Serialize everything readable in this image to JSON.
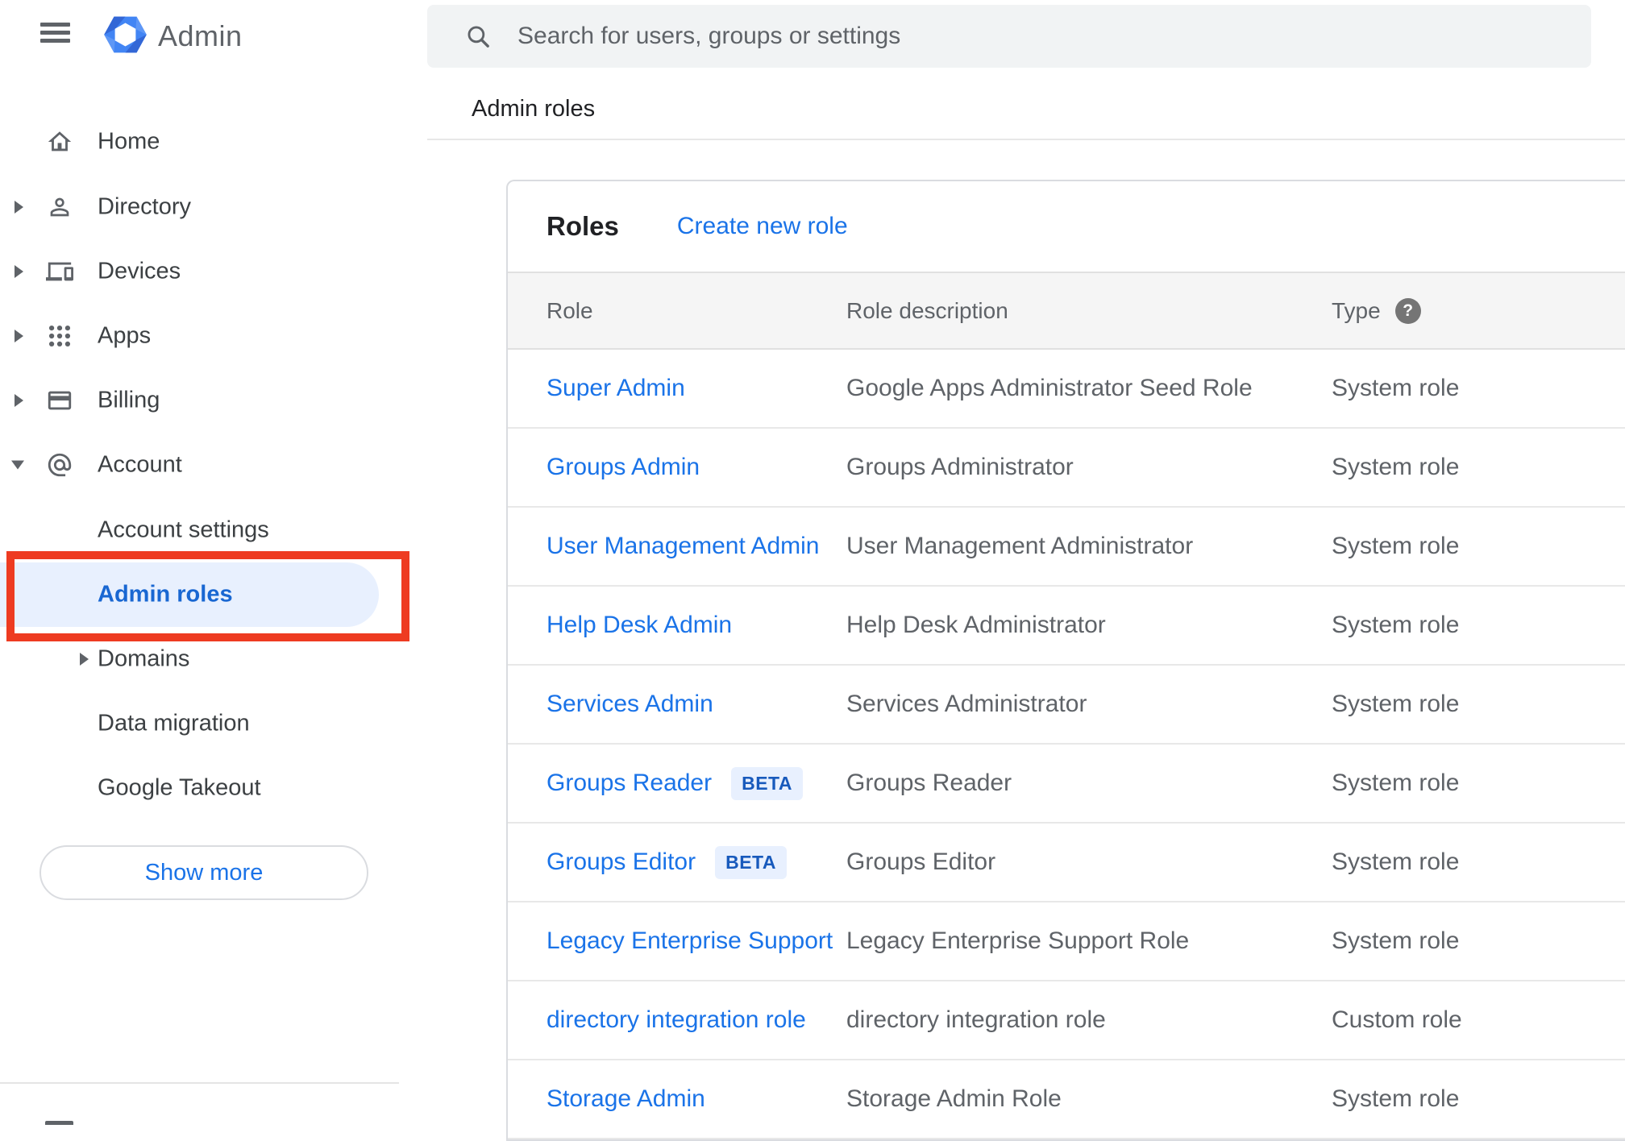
{
  "header": {
    "app_title": "Admin",
    "search_placeholder": "Search for users, groups or settings",
    "breadcrumb": "Admin roles"
  },
  "sidebar": {
    "items": [
      {
        "label": "Home",
        "icon": "home-icon"
      },
      {
        "label": "Directory",
        "icon": "person-icon"
      },
      {
        "label": "Devices",
        "icon": "devices-icon"
      },
      {
        "label": "Apps",
        "icon": "apps-grid-icon"
      },
      {
        "label": "Billing",
        "icon": "credit-card-icon"
      },
      {
        "label": "Account",
        "icon": "at-sign-icon"
      }
    ],
    "account_children": [
      {
        "label": "Account settings"
      },
      {
        "label": "Admin roles",
        "active": true
      },
      {
        "label": "Domains"
      },
      {
        "label": "Data migration"
      },
      {
        "label": "Google Takeout"
      }
    ],
    "show_more_label": "Show more"
  },
  "main": {
    "card_title": "Roles",
    "create_link_label": "Create new role",
    "table": {
      "columns": [
        "Role",
        "Role description",
        "Type"
      ],
      "type_help_glyph": "?",
      "rows": [
        {
          "role": "Super Admin",
          "description": "Google Apps Administrator Seed Role",
          "type": "System role"
        },
        {
          "role": "Groups Admin",
          "description": "Groups Administrator",
          "type": "System role"
        },
        {
          "role": "User Management Admin",
          "description": "User Management Administrator",
          "type": "System role"
        },
        {
          "role": "Help Desk Admin",
          "description": "Help Desk Administrator",
          "type": "System role"
        },
        {
          "role": "Services Admin",
          "description": "Services Administrator",
          "type": "System role"
        },
        {
          "role": "Groups Reader",
          "badge": "BETA",
          "description": "Groups Reader",
          "type": "System role"
        },
        {
          "role": "Groups Editor",
          "badge": "BETA",
          "description": "Groups Editor",
          "type": "System role"
        },
        {
          "role": "Legacy Enterprise Support",
          "description": "Legacy Enterprise Support Role",
          "type": "System role"
        },
        {
          "role": "directory integration role",
          "description": "directory integration role",
          "type": "Custom role"
        },
        {
          "role": "Storage Admin",
          "description": "Storage Admin Role",
          "type": "System role"
        }
      ]
    }
  },
  "colors": {
    "link_blue": "#1a73e8",
    "active_item_blue": "#1967d2",
    "active_item_bg": "#e8f0fe",
    "annotation_red": "#ee3b21",
    "beta_text": "#185abc",
    "beta_bg": "#e8f0fe",
    "search_bg": "#f1f3f4",
    "table_header_bg": "#f5f5f5",
    "icon_gray": "#5f6368"
  }
}
